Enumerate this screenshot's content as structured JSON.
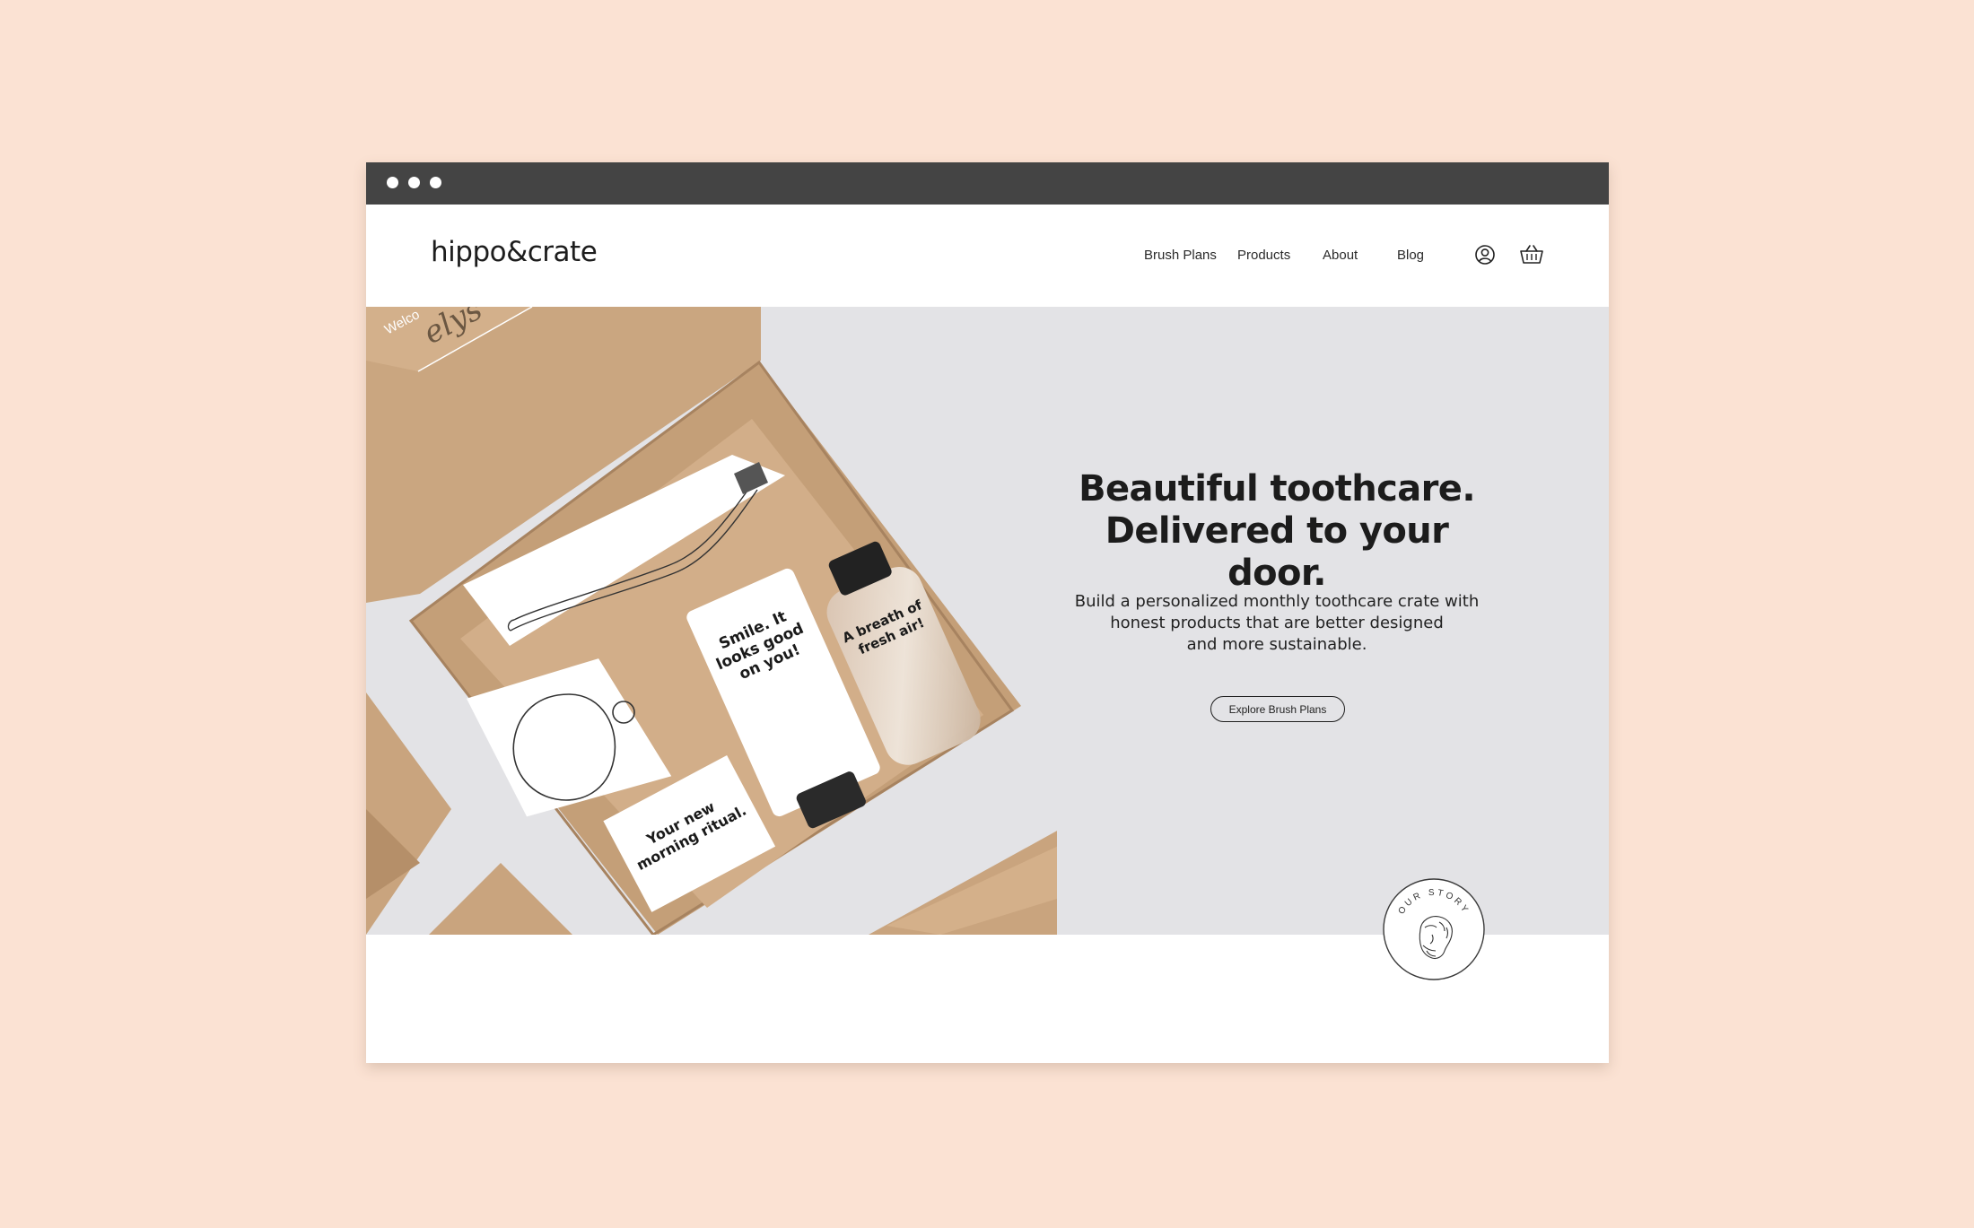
{
  "brand": {
    "logo": "hippo&crate",
    "background_color": "#fbe2d3",
    "window_bar_color": "#444444",
    "hero_background": "#e3e3e6"
  },
  "nav": {
    "items": [
      {
        "label": "Brush Plans"
      },
      {
        "label": "Products"
      },
      {
        "label": "About"
      },
      {
        "label": "Blog"
      }
    ],
    "icons": [
      "account-icon",
      "basket-icon"
    ]
  },
  "hero": {
    "title_lines": [
      "Beautiful toothcare.",
      "Delivered to your door."
    ],
    "subtitle_lines": [
      "Build a personalized monthly toothcare crate with",
      "honest products that are better designed",
      "and more sustainable."
    ],
    "cta_label": "Explore Brush Plans",
    "image": {
      "card_welcome": "Welco",
      "card_name": "elys",
      "tube_text": [
        "Smile. It",
        "looks good",
        "on you!"
      ],
      "bottle_text": [
        "A breath of",
        "fresh air!"
      ],
      "box_text": [
        "Your new",
        "morning ritual."
      ]
    }
  },
  "badge": {
    "label": "OUR STORY"
  }
}
